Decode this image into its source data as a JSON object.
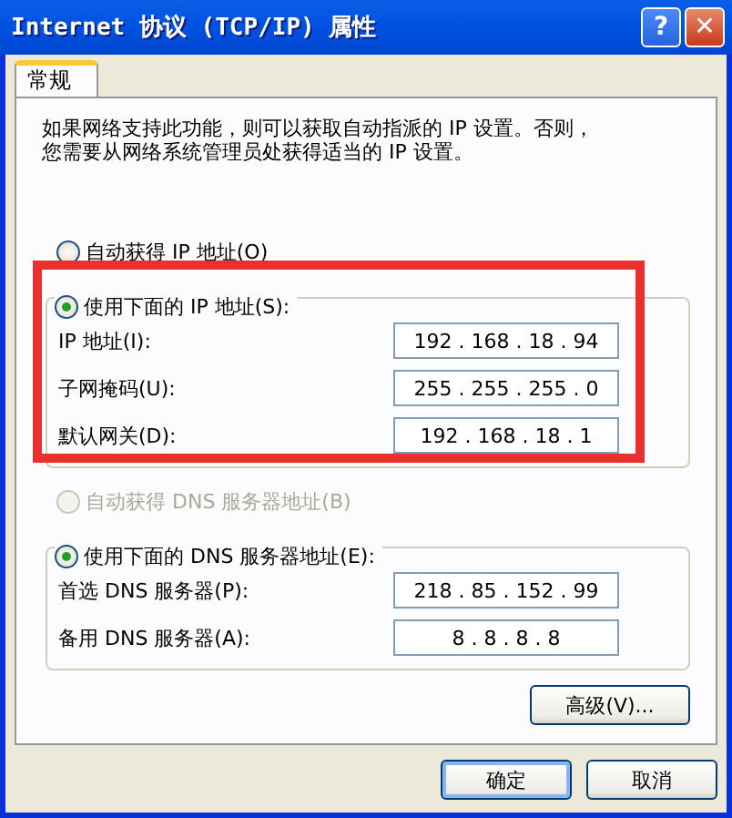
{
  "window": {
    "title": "Internet 协议 (TCP/IP) 属性",
    "help_button": "?",
    "close_button": "✕"
  },
  "tabs": [
    {
      "label": "常规",
      "selected": true
    }
  ],
  "description": [
    "如果网络支持此功能，则可以获取自动指派的 IP 设置。否则，",
    "您需要从网络系统管理员处获得适当的 IP 设置。"
  ],
  "ip_options": [
    {
      "label": "自动获得 IP 地址(O)",
      "selected": false,
      "disabled": false
    }
  ],
  "ip_group": {
    "legend": {
      "label": "使用下面的 IP 地址(S):",
      "selected": true,
      "disabled": false
    },
    "fields": [
      {
        "label": "IP 地址(I):",
        "value": "192 . 168 . 18 . 94"
      },
      {
        "label": "子网掩码(U):",
        "value": "255 . 255 . 255 . 0"
      },
      {
        "label": "默认网关(D):",
        "value": "192 . 168 . 18 . 1"
      }
    ]
  },
  "dns_options": [
    {
      "label": "自动获得 DNS 服务器地址(B)",
      "selected": false,
      "disabled": true
    }
  ],
  "dns_group": {
    "legend": {
      "label": "使用下面的 DNS 服务器地址(E):",
      "selected": true,
      "disabled": false
    },
    "fields": [
      {
        "label": "首选 DNS 服务器(P):",
        "value": "218 . 85 . 152 . 99"
      },
      {
        "label": "备用 DNS 服务器(A):",
        "value": "8 . 8 . 8 . 8"
      }
    ]
  },
  "advanced_button": "高级(V)...",
  "buttons": [
    "确定",
    "取消"
  ],
  "highlight": true
}
